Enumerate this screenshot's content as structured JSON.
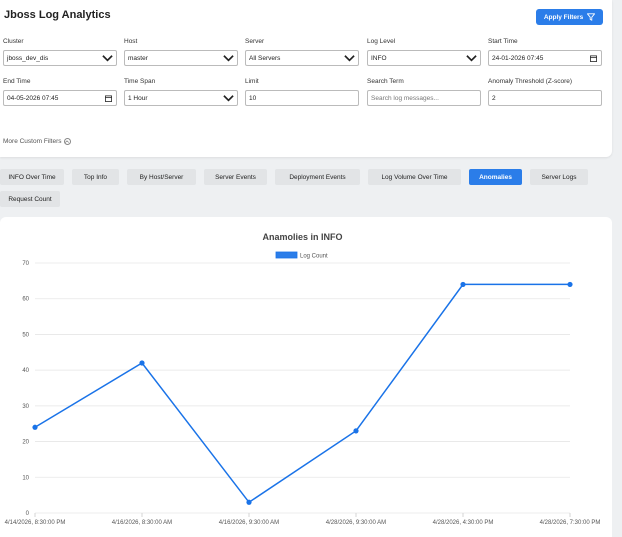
{
  "header": {
    "title": "Jboss Log Analytics",
    "apply_label": "Apply Filters"
  },
  "filters": {
    "cluster": {
      "label": "Cluster",
      "value": "jboss_dev_dis"
    },
    "host": {
      "label": "Host",
      "value": "master"
    },
    "server": {
      "label": "Server",
      "value": "All Servers"
    },
    "log_level": {
      "label": "Log Level",
      "value": "INFO"
    },
    "start_time": {
      "label": "Start Time",
      "value": "24-01-2026 07:45"
    },
    "end_time": {
      "label": "End Time",
      "value": "04-05-2026 07:45"
    },
    "time_span": {
      "label": "Time Span",
      "value": "1 Hour"
    },
    "limit": {
      "label": "Limit",
      "value": "10"
    },
    "search_term": {
      "label": "Search Term",
      "placeholder": "Search log messages..."
    },
    "anomaly_threshold": {
      "label": "Anomaly Threshold (Z-score)",
      "value": "2"
    },
    "more_label": "More Custom Filters"
  },
  "tabs": [
    {
      "label": "INFO Over Time"
    },
    {
      "label": "Top Info"
    },
    {
      "label": "By Host/Server"
    },
    {
      "label": "Server Events"
    },
    {
      "label": "Deployment Events"
    },
    {
      "label": "Log Volume Over Time"
    },
    {
      "label": "Anomalies",
      "active": true
    },
    {
      "label": "Server Logs"
    },
    {
      "label": "Request Count"
    }
  ],
  "colors": {
    "accent": "#2b7de9",
    "line": "#1a73e8"
  },
  "chart_data": {
    "type": "line",
    "title": "Anamolies in INFO",
    "xlabel": "",
    "ylabel": "",
    "categories": [
      "4/14/2026, 8:30:00 PM",
      "4/16/2026, 8:30:00 AM",
      "4/16/2026, 9:30:00 AM",
      "4/28/2026, 9:30:00 AM",
      "4/28/2026, 4:30:00 PM",
      "4/28/2026, 7:30:00 PM"
    ],
    "series": [
      {
        "name": "Log Count",
        "values": [
          24,
          42,
          3,
          23,
          64,
          64
        ]
      }
    ],
    "ylim": [
      0,
      70
    ],
    "yticks": [
      0,
      10,
      20,
      30,
      40,
      50,
      60,
      70
    ],
    "grid": true,
    "legend": "top-center"
  }
}
